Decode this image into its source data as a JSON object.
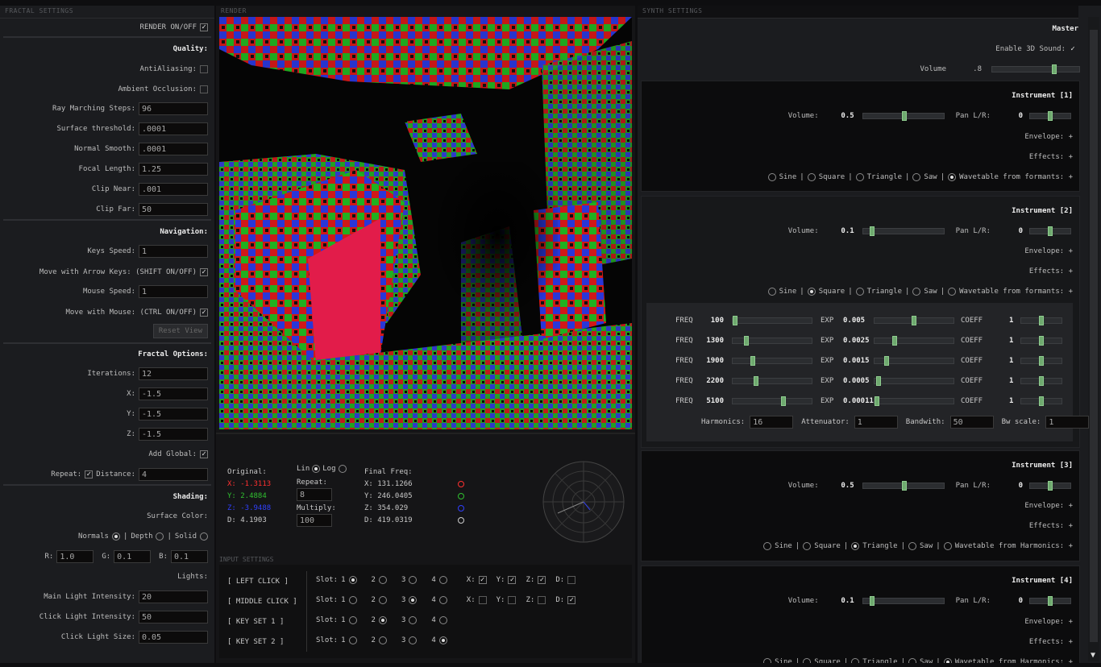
{
  "left": {
    "title": "FRACTAL SETTINGS",
    "render": "RENDER ON/OFF",
    "quality": "Quality:",
    "antialias": "AntiAliasing:",
    "ao": "Ambient Occlusion:",
    "ray_steps": {
      "label": "Ray Marching Steps:",
      "value": "96"
    },
    "surface_threshold": {
      "label": "Surface threshold:",
      "value": ".0001"
    },
    "normal_smooth": {
      "label": "Normal Smooth:",
      "value": ".0001"
    },
    "focal": {
      "label": "Focal Length:",
      "value": "1.25"
    },
    "clip_near": {
      "label": "Clip Near:",
      "value": ".001"
    },
    "clip_far": {
      "label": "Clip Far:",
      "value": "50"
    },
    "navigation": "Navigation:",
    "keys_speed": {
      "label": "Keys Speed:",
      "value": "1"
    },
    "arrow_keys": "Move with Arrow Keys: (SHIFT ON/OFF)",
    "mouse_speed": {
      "label": "Mouse Speed:",
      "value": "1"
    },
    "move_mouse": "Move with Mouse: (CTRL ON/OFF)",
    "reset_view": "Reset View",
    "fractal_options": "Fractal Options:",
    "iterations": {
      "label": "Iterations:",
      "value": "12"
    },
    "x": {
      "label": "X:",
      "value": "-1.5"
    },
    "y": {
      "label": "Y:",
      "value": "-1.5"
    },
    "z": {
      "label": "Z:",
      "value": "-1.5"
    },
    "add_global": "Add Global:",
    "repeat": "Repeat:",
    "distance": {
      "label": "Distance:",
      "value": "4"
    },
    "shading": "Shading:",
    "surface_color": "Surface Color:",
    "normals": "Normals",
    "depth": "Depth",
    "solid": "Solid",
    "r": {
      "label": "R:",
      "value": "1.0"
    },
    "g": {
      "label": "G:",
      "value": "0.1"
    },
    "b": {
      "label": "B:",
      "value": "0.1"
    },
    "lights": "Lights:",
    "main_light": {
      "label": "Main Light Intensity:",
      "value": "20"
    },
    "click_light": {
      "label": "Click Light Intensity:",
      "value": "50"
    },
    "click_light_size": {
      "label": "Click Light Size:",
      "value": "0.05"
    }
  },
  "render": {
    "title": "RENDER",
    "original": "Original:",
    "ox": "X: -1.3113",
    "oy": "Y: 2.4884",
    "oz": "Z: -3.9488",
    "od": "D: 4.1903",
    "lin": "Lin",
    "log": "Log",
    "repeat_label": "Repeat:",
    "repeat_value": "8",
    "multiply_label": "Multiply:",
    "multiply_value": "100",
    "final": "Final Freq:",
    "fx": "X: 131.1266",
    "fy": "Y: 246.0405",
    "fz": "Z: 354.029",
    "fd": "D: 419.0319",
    "colors": {
      "x": "#ff3030",
      "y": "#30c030",
      "z": "#3040ff",
      "d": "#cccccc"
    }
  },
  "input": {
    "title": "INPUT SETTINGS",
    "rows": [
      {
        "name": "[ LEFT CLICK ]",
        "slot": "Slot:",
        "s1": "1",
        "s2": "2",
        "s3": "3",
        "s4": "4",
        "x": "X:",
        "y": "Y:",
        "z": "Z:",
        "d": "D:"
      },
      {
        "name": "[ MIDDLE CLICK ]",
        "slot": "Slot:",
        "s1": "1",
        "s2": "2",
        "s3": "3",
        "s4": "4",
        "x": "X:",
        "y": "Y:",
        "z": "Z:",
        "d": "D:"
      },
      {
        "name": "[ KEY SET 1 ]",
        "slot": "Slot:",
        "s1": "1",
        "s2": "2",
        "s3": "3",
        "s4": "4"
      },
      {
        "name": "[ KEY SET 2 ]",
        "slot": "Slot:",
        "s1": "1",
        "s2": "2",
        "s3": "3",
        "s4": "4"
      }
    ]
  },
  "synth": {
    "title": "SYNTH SETTINGS",
    "master": "Master",
    "enable3d": "Enable 3D Sound:",
    "volume_label": "Volume",
    "volume_value": ".8",
    "volume_level": 0.8,
    "envelope": "Envelope: +",
    "effects": "Effects: +",
    "sine": "Sine",
    "square": "Square",
    "triangle": "Triangle",
    "saw": "Saw",
    "wt_formants": "Wavetable from formants: +",
    "wt_harmonics": "Wavetable from Harmonics: +",
    "vol": "Volume:",
    "pan": "Pan L/R:",
    "instruments": [
      {
        "title": "Instrument [1]",
        "volume": "0.5",
        "pan": "0"
      },
      {
        "title": "Instrument [2]",
        "volume": "0.1",
        "pan": "0"
      },
      {
        "title": "Instrument [3]",
        "volume": "0.5",
        "pan": "0"
      },
      {
        "title": "Instrument [4]",
        "volume": "0.1",
        "pan": "0"
      }
    ],
    "formants": [
      {
        "freq": "100",
        "exp": "0.005",
        "coeff": "1"
      },
      {
        "freq": "1300",
        "exp": "0.0025",
        "coeff": "1"
      },
      {
        "freq": "1900",
        "exp": "0.0015",
        "coeff": "1"
      },
      {
        "freq": "2200",
        "exp": "0.0005",
        "coeff": "1"
      },
      {
        "freq": "5100",
        "exp": "0.00011",
        "coeff": "1"
      }
    ],
    "freq_label": "FREQ",
    "exp_label": "EXP",
    "coeff_label": "COEFF",
    "harmonics": {
      "label": "Harmonics:",
      "value": "16"
    },
    "attenuator": {
      "label": "Attenuator:",
      "value": "1"
    },
    "bandwidth": {
      "label": "Bandwith:",
      "value": "50"
    },
    "bwscale": {
      "label": "Bw scale:",
      "value": "1"
    }
  }
}
